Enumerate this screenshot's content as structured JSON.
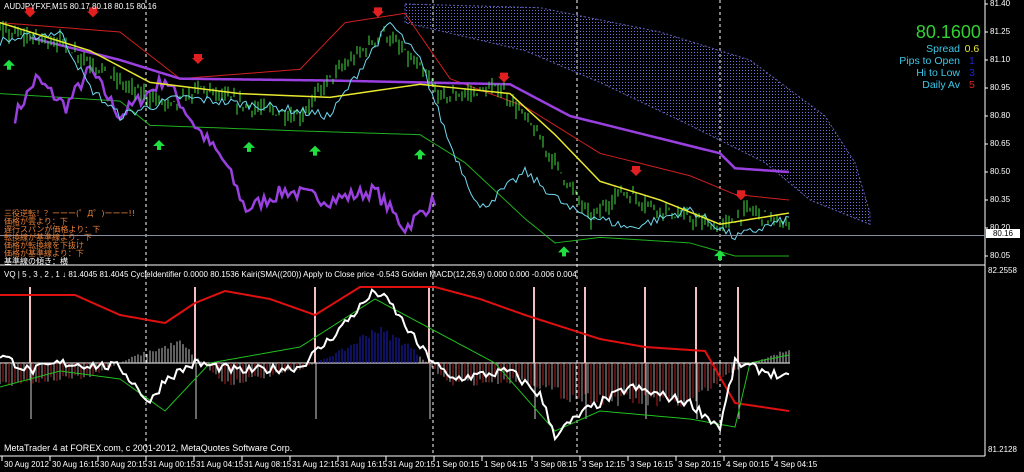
{
  "header": {
    "symbol_line": "AUDJPYFXF,M15  80.17 80.18 80.15 80.16",
    "indicator_line": "VQ | 5 , 3 , 2 , 1 ↓ 81.4045 81.4045  CycleIdentifier 0.0000 80.1536  Kairi(SMA((200)) Apply to Close price -0.543  Golden MACD(12,26,9) 0.000 0.000 -0.006 0.004",
    "copyright": "MetaTrader 4 at FOREX.com, c 2001-2012, MetaQuotes Software Corp."
  },
  "info_panel": {
    "price": "80.1600",
    "rows": [
      {
        "label": "Spread",
        "value": "0.6",
        "color": "#e8e830"
      },
      {
        "label": "Pips to Open",
        "value": "1",
        "color": "#2020d0"
      },
      {
        "label": "Hi to Low",
        "value": "3",
        "color": "#2020d0"
      },
      {
        "label": "Daily Av",
        "value": "5",
        "color": "#e02020"
      }
    ]
  },
  "signals_text": [
    "三役逆転！？ーーー(゜Д゜)ーーー!!",
    "価格が雲より：下",
    "遅行スパンが価格より：下",
    "転換線が基準線より：下",
    "価格が転換線を下抜け",
    "価格が基準線より：下",
    "基準線の傾き：横"
  ],
  "current_price_label": "80.16",
  "colors": {
    "candles": "#40e040",
    "ma": "#e8e830",
    "cyan": "#70d8f0",
    "purple": "#9a40e0",
    "red": "#d02020",
    "green": "#20b020",
    "cloud": "#5050c0"
  },
  "chart_data": {
    "type": "line",
    "title": "AUDJPYFXF,M15",
    "x_unit": "M15 bar index",
    "x_tick_labels": [
      "30 Aug 2012",
      "30 Aug 16:15",
      "30 Aug 20:15",
      "31 Aug 00:15",
      "31 Aug 04:15",
      "31 Aug 08:15",
      "31 Aug 12:15",
      "31 Aug 16:15",
      "31 Aug 20:15",
      "1 Sep 00:15",
      "1 Sep 04:15",
      "3 Sep 08:15",
      "3 Sep 12:15",
      "3 Sep 16:15",
      "3 Sep 20:15",
      "4 Sep 00:15",
      "4 Sep 04:15"
    ],
    "main_panel": {
      "y_ticks": [
        "81.40",
        "81.25",
        "81.10",
        "80.95",
        "80.80",
        "80.65",
        "80.50",
        "80.35",
        "80.20",
        "80.05"
      ],
      "ylim": [
        80.05,
        81.4
      ],
      "series": [
        {
          "name": "close",
          "points": [
            [
              0,
              81.25
            ],
            [
              20,
              81.2
            ],
            [
              43,
              80.95
            ],
            [
              57,
              80.85
            ],
            [
              67,
              80.95
            ],
            [
              83,
              80.85
            ],
            [
              100,
              80.8
            ],
            [
              110,
              81.0
            ],
            [
              128,
              81.25
            ],
            [
              140,
              81.05
            ],
            [
              147,
              80.9
            ],
            [
              167,
              80.95
            ],
            [
              177,
              80.75
            ],
            [
              187,
              80.5
            ],
            [
              197,
              80.25
            ],
            [
              207,
              80.4
            ],
            [
              220,
              80.3
            ],
            [
              240,
              80.2
            ],
            [
              250,
              80.3
            ],
            [
              263,
              80.2
            ]
          ]
        },
        {
          "name": "ma-yellow",
          "points": [
            [
              0,
              81.3
            ],
            [
              30,
              81.15
            ],
            [
              50,
              80.98
            ],
            [
              80,
              80.92
            ],
            [
              110,
              80.9
            ],
            [
              140,
              80.97
            ],
            [
              170,
              80.92
            ],
            [
              185,
              80.7
            ],
            [
              200,
              80.45
            ],
            [
              220,
              80.35
            ],
            [
              240,
              80.22
            ],
            [
              263,
              80.28
            ]
          ]
        },
        {
          "name": "line-cyan",
          "points": [
            [
              0,
              81.2
            ],
            [
              20,
              81.25
            ],
            [
              30,
              80.95
            ],
            [
              40,
              80.8
            ],
            [
              60,
              80.9
            ],
            [
              90,
              80.85
            ],
            [
              110,
              80.8
            ],
            [
              130,
              81.3
            ],
            [
              140,
              81.1
            ],
            [
              150,
              80.65
            ],
            [
              160,
              80.3
            ],
            [
              175,
              80.5
            ],
            [
              190,
              80.3
            ],
            [
              210,
              80.2
            ],
            [
              230,
              80.3
            ],
            [
              245,
              80.15
            ],
            [
              263,
              80.25
            ]
          ]
        },
        {
          "name": "purple-lower",
          "points": [
            [
              5,
              80.8
            ],
            [
              12,
              81.0
            ],
            [
              22,
              80.85
            ],
            [
              30,
              81.05
            ],
            [
              40,
              80.8
            ],
            [
              55,
              81.0
            ],
            [
              65,
              80.75
            ],
            [
              75,
              80.55
            ],
            [
              82,
              80.3
            ],
            [
              95,
              80.4
            ],
            [
              110,
              80.35
            ],
            [
              125,
              80.4
            ],
            [
              135,
              80.2
            ],
            [
              145,
              80.35
            ]
          ]
        },
        {
          "name": "purple-upper",
          "points": [
            [
              10,
              81.22
            ],
            [
              40,
              81.1
            ],
            [
              60,
              81.0
            ],
            [
              110,
              80.99
            ],
            [
              170,
              80.97
            ],
            [
              190,
              80.8
            ],
            [
              220,
              80.68
            ],
            [
              240,
              80.6
            ],
            [
              245,
              80.52
            ],
            [
              263,
              80.5
            ]
          ]
        },
        {
          "name": "band-red",
          "points": [
            [
              0,
              81.3
            ],
            [
              40,
              81.25
            ],
            [
              60,
              81.0
            ],
            [
              100,
              81.05
            ],
            [
              115,
              81.3
            ],
            [
              135,
              81.35
            ],
            [
              150,
              81.0
            ],
            [
              175,
              80.85
            ],
            [
              200,
              80.6
            ],
            [
              230,
              80.48
            ],
            [
              245,
              80.38
            ],
            [
              263,
              80.35
            ]
          ]
        },
        {
          "name": "band-green",
          "points": [
            [
              0,
              80.92
            ],
            [
              40,
              80.88
            ],
            [
              50,
              80.75
            ],
            [
              100,
              80.72
            ],
            [
              140,
              80.7
            ],
            [
              155,
              80.55
            ],
            [
              175,
              80.25
            ],
            [
              185,
              80.12
            ],
            [
              200,
              80.15
            ],
            [
              230,
              80.12
            ],
            [
              245,
              80.05
            ],
            [
              263,
              80.05
            ]
          ]
        }
      ],
      "cloud": {
        "upper": [
          [
            135,
            81.4
          ],
          [
            180,
            81.38
          ],
          [
            220,
            81.25
          ],
          [
            250,
            81.1
          ],
          [
            275,
            80.8
          ],
          [
            285,
            80.55
          ],
          [
            290,
            80.28
          ]
        ],
        "lower": [
          [
            135,
            81.3
          ],
          [
            175,
            81.15
          ],
          [
            200,
            80.98
          ],
          [
            230,
            80.75
          ],
          [
            255,
            80.55
          ],
          [
            270,
            80.35
          ],
          [
            290,
            80.22
          ]
        ]
      },
      "sell_arrows": [
        [
          10,
          81.35
        ],
        [
          31,
          81.35
        ],
        [
          66,
          81.1
        ],
        [
          126,
          81.35
        ],
        [
          168,
          81.0
        ],
        [
          212,
          80.5
        ],
        [
          247,
          80.37
        ]
      ],
      "buy_arrows": [
        [
          3,
          81.08
        ],
        [
          53,
          80.65
        ],
        [
          83,
          80.64
        ],
        [
          105,
          80.62
        ],
        [
          140,
          80.6
        ],
        [
          188,
          80.08
        ],
        [
          240,
          80.06
        ]
      ]
    },
    "lower_panel": {
      "y_ticks": [
        "82.2558",
        "81.2128"
      ],
      "series": [
        {
          "name": "white",
          "points": [
            [
              0,
              0.1
            ],
            [
              10,
              -0.1
            ],
            [
              20,
              0
            ],
            [
              40,
              -0.05
            ],
            [
              50,
              -0.5
            ],
            [
              55,
              -0.2
            ],
            [
              65,
              0
            ],
            [
              80,
              -0.1
            ],
            [
              100,
              -0.05
            ],
            [
              110,
              0.3
            ],
            [
              125,
              0.9
            ],
            [
              130,
              0.75
            ],
            [
              140,
              0.2
            ],
            [
              150,
              -0.2
            ],
            [
              170,
              -0.1
            ],
            [
              180,
              -0.4
            ],
            [
              185,
              -0.9
            ],
            [
              195,
              -0.6
            ],
            [
              210,
              -0.3
            ],
            [
              230,
              -0.5
            ],
            [
              240,
              -0.8
            ],
            [
              245,
              0
            ],
            [
              255,
              -0.1
            ],
            [
              263,
              -0.2
            ]
          ]
        },
        {
          "name": "red",
          "points": [
            [
              0,
              0.85
            ],
            [
              25,
              0.85
            ],
            [
              40,
              0.6
            ],
            [
              55,
              0.5
            ],
            [
              65,
              0.75
            ],
            [
              75,
              0.9
            ],
            [
              90,
              0.8
            ],
            [
              105,
              0.6
            ],
            [
              120,
              0.95
            ],
            [
              145,
              0.95
            ],
            [
              160,
              0.8
            ],
            [
              175,
              0.6
            ],
            [
              200,
              0.3
            ],
            [
              215,
              0.2
            ],
            [
              235,
              0.15
            ],
            [
              245,
              -0.5
            ],
            [
              263,
              -0.6
            ]
          ]
        },
        {
          "name": "green",
          "points": [
            [
              0,
              -0.3
            ],
            [
              20,
              -0.1
            ],
            [
              40,
              -0.2
            ],
            [
              55,
              -0.6
            ],
            [
              70,
              0
            ],
            [
              100,
              0.2
            ],
            [
              125,
              0.8
            ],
            [
              140,
              0.5
            ],
            [
              165,
              0
            ],
            [
              185,
              -0.85
            ],
            [
              200,
              -0.6
            ],
            [
              230,
              -0.7
            ],
            [
              245,
              -0.8
            ],
            [
              250,
              0
            ],
            [
              263,
              0.1
            ]
          ]
        }
      ],
      "histogram": [
        [
          0,
          -0.3
        ],
        [
          30,
          -0.2
        ],
        [
          45,
          0.1
        ],
        [
          60,
          0.3
        ],
        [
          75,
          -0.3
        ],
        [
          100,
          -0.1
        ],
        [
          115,
          0.2
        ],
        [
          125,
          0.5
        ],
        [
          135,
          0.3
        ],
        [
          150,
          -0.3
        ],
        [
          175,
          -0.25
        ],
        [
          190,
          -0.5
        ],
        [
          230,
          -0.6
        ],
        [
          245,
          -0.1
        ],
        [
          263,
          0.2
        ]
      ],
      "spikes": [
        10,
        65,
        105,
        143,
        178,
        195,
        215,
        232,
        246
      ]
    }
  }
}
